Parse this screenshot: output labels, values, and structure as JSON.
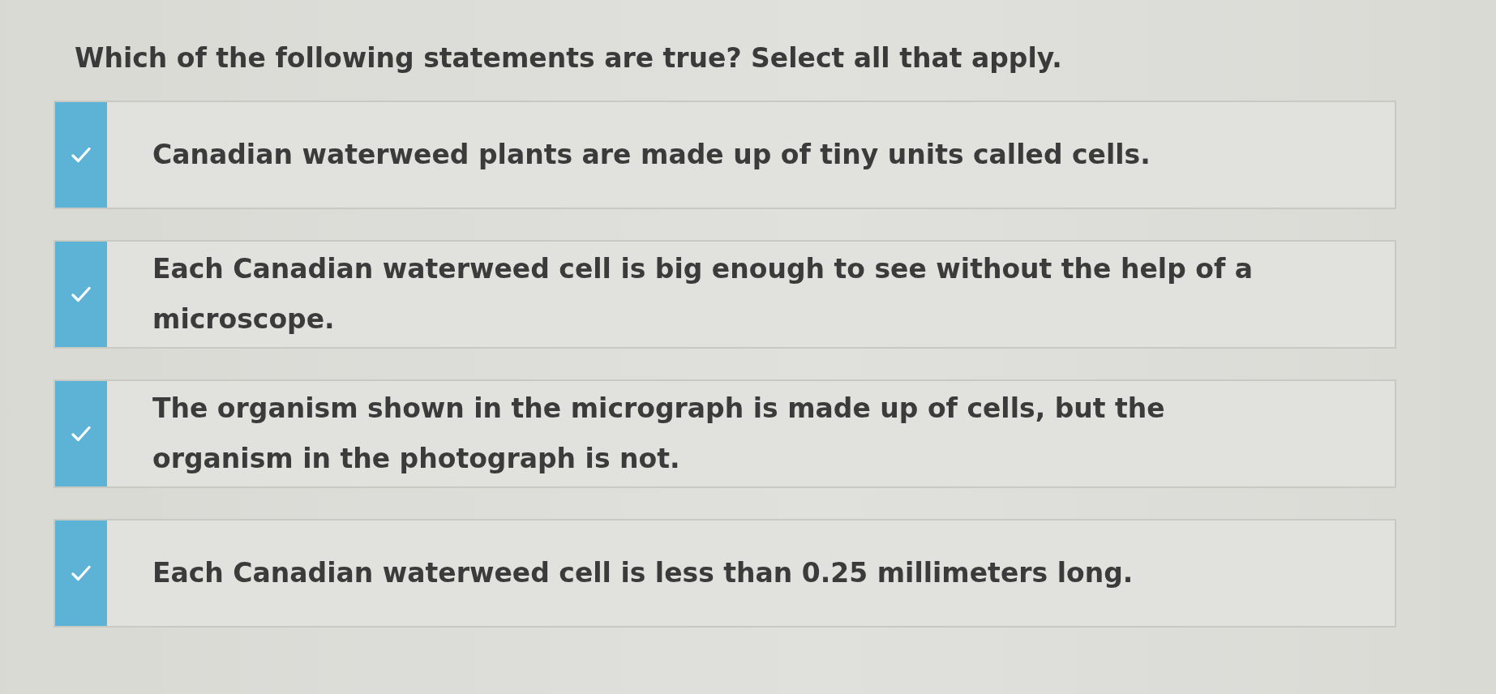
{
  "question": "Which of the following statements are true? Select all that apply.",
  "options": [
    {
      "text": "Canadian waterweed plants are made up of tiny units called cells.",
      "selected": true
    },
    {
      "text": "Each Canadian waterweed cell is big enough to see without the help of a microscope.",
      "selected": true
    },
    {
      "text": "The organism shown in the micrograph is made up of cells, but the organism in the photograph is not.",
      "selected": true
    },
    {
      "text": "Each Canadian waterweed cell is less than 0.25 millimeters long.",
      "selected": true
    }
  ]
}
